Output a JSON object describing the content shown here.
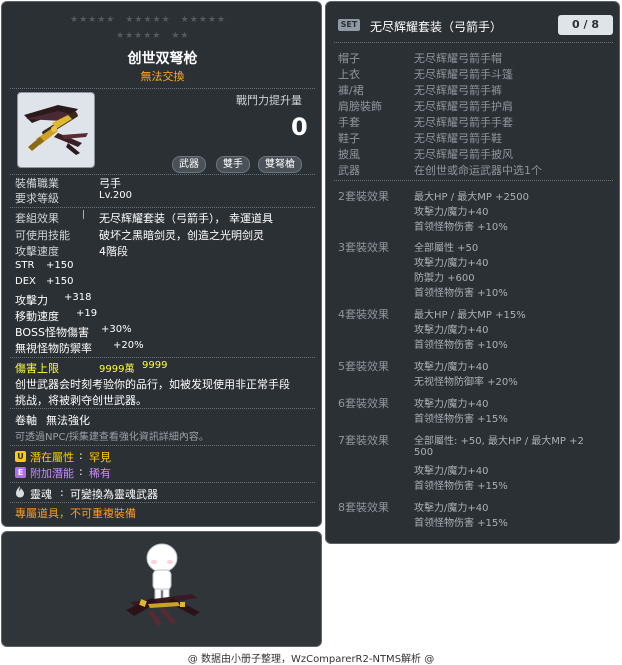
{
  "item_id": "01522152",
  "item": {
    "name": "创世双弩枪",
    "trade": "無法交換",
    "combat_power_label": "戰鬥力提升量",
    "combat_power_value": "0",
    "tags": [
      "武器",
      "雙手",
      "雙弩槍"
    ],
    "job_label": "裝備職業",
    "job_value": "弓手",
    "level_label": "要求等級",
    "level_value": "Lv.200",
    "set_effect_label": "套組效果",
    "set_effect_value": "无尽辉耀套装（弓箭手）， 幸運道具",
    "skills_label": "可使用技能",
    "skills_value": "破坏之黑暗剑灵，创造之光明剑灵",
    "speed_label": "攻擊速度",
    "speed_value": "4階段",
    "stats": [
      {
        "label": "STR",
        "value": "+150"
      },
      {
        "label": "DEX",
        "value": "+150"
      },
      {
        "label": "攻擊力",
        "value": "+318"
      },
      {
        "label": "移動速度",
        "value": "+19"
      },
      {
        "label": "BOSS怪物傷害",
        "value": "+30%"
      },
      {
        "label": "無視怪物防禦率",
        "value": "+20%"
      }
    ],
    "damage_cap_label": "傷害上限",
    "damage_cap_value1": "9999萬",
    "damage_cap_value2": "9999",
    "description_line1": "创世武器会时刻考验你的品行，如被发现使用非正常手段",
    "description_line2": "挑战，将被剥夺创世武器。",
    "scroll_label": "卷軸",
    "scroll_value": "無法強化",
    "scroll_hint": "可透過NPC/採集建查看強化資訊詳細內容。",
    "potential_label": "潛在屬性",
    "potential_value": "罕見",
    "addl_label": "附加潛能",
    "addl_value": "稀有",
    "soul_label": "靈魂",
    "soul_value": "可變換為靈魂武器",
    "exclusive": "專屬道具，不可重複裝備"
  },
  "set": {
    "badge": "SET",
    "name": "无尽辉耀套装（弓箭手）",
    "count": "0 / 8",
    "parts": [
      {
        "slot": "帽子",
        "item": "无尽辉耀弓箭手帽"
      },
      {
        "slot": "上衣",
        "item": "无尽辉耀弓箭手斗篷"
      },
      {
        "slot": "褲/裙",
        "item": "无尽辉耀弓箭手裤"
      },
      {
        "slot": "肩膀裝飾",
        "item": "无尽辉耀弓箭手护肩"
      },
      {
        "slot": "手套",
        "item": "无尽辉耀弓箭手手套"
      },
      {
        "slot": "鞋子",
        "item": "无尽辉耀弓箭手鞋"
      },
      {
        "slot": "披風",
        "item": "无尽辉耀弓箭手披风"
      },
      {
        "slot": "武器",
        "item": "在创世或命运武器中选1个"
      }
    ],
    "effects": [
      {
        "label": "2套裝效果",
        "lines": [
          "最大HP / 最大MP  +2500",
          "攻擊力/魔力+40",
          "首领怪物伤害 +10%"
        ]
      },
      {
        "label": "3套裝效果",
        "lines": [
          "全部屬性 +50",
          "攻擊力/魔力+40",
          "防禦力 +600",
          "首领怪物伤害 +10%"
        ]
      },
      {
        "label": "4套裝效果",
        "lines": [
          "最大HP / 最大MP  +15%",
          "攻擊力/魔力+40",
          "首领怪物伤害 +10%"
        ]
      },
      {
        "label": "5套裝效果",
        "lines": [
          "攻擊力/魔力+40",
          "无视怪物防御率 +20%"
        ]
      },
      {
        "label": "6套裝效果",
        "lines": [
          "攻擊力/魔力+40",
          "首领怪物伤害 +15%"
        ]
      },
      {
        "label": "7套裝效果",
        "lines": [
          "全部屬性: +50, 最大HP / 最大MP  +2",
          "500",
          "攻擊力/魔力+40",
          "首领怪物伤害 +15%"
        ]
      },
      {
        "label": "8套裝效果",
        "lines": [
          "攻擊力/魔力+40",
          "首领怪物伤害 +15%"
        ]
      }
    ]
  },
  "footer": "@ 数据由小册子整理，WzComparerR2-NTMS解析 @",
  "colors": {
    "panel_bg": "#2b3035",
    "orange": "#ff9a1e",
    "yellow": "#ffff33",
    "potential_gold": "#ffcc00",
    "potential_purple": "#b06aff"
  },
  "icons": {
    "weapon": "crossbow-icon",
    "potential": "potential-u-icon",
    "additional": "potential-e-icon",
    "soul": "soul-flame-icon"
  }
}
